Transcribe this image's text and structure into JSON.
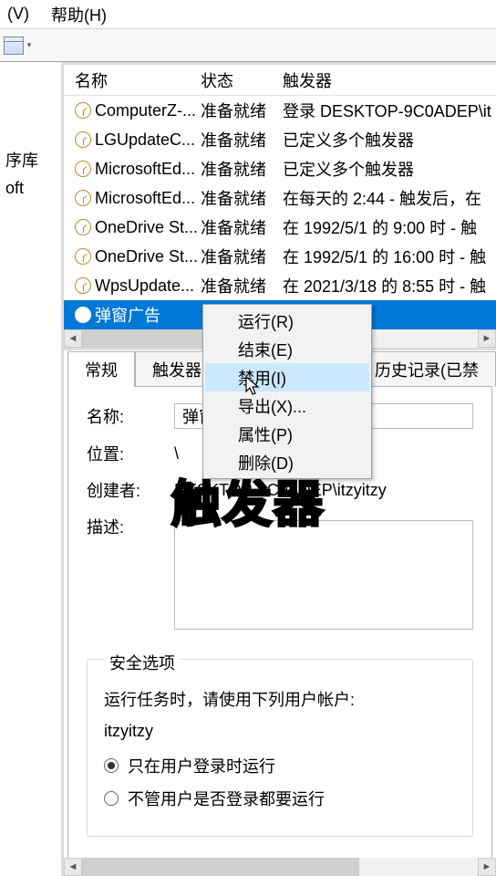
{
  "menubar": {
    "v": "(V)",
    "help": "帮助(H)"
  },
  "sidebar": {
    "lib": "序库",
    "oft": "oft"
  },
  "columns": {
    "name": "名称",
    "state": "状态",
    "trigger": "触发器"
  },
  "tasks": [
    {
      "name": "ComputerZ-...",
      "state": "准备就绪",
      "trigger": "登录 DESKTOP-9C0ADEP\\it"
    },
    {
      "name": "LGUpdateC...",
      "state": "准备就绪",
      "trigger": "已定义多个触发器"
    },
    {
      "name": "MicrosoftEd...",
      "state": "准备就绪",
      "trigger": "已定义多个触发器"
    },
    {
      "name": "MicrosoftEd...",
      "state": "准备就绪",
      "trigger": "在每天的 2:44 - 触发后，在"
    },
    {
      "name": "OneDrive St...",
      "state": "准备就绪",
      "trigger": "在 1992/5/1 的 9:00 时 - 触"
    },
    {
      "name": "OneDrive St...",
      "state": "准备就绪",
      "trigger": "在 1992/5/1 的 16:00 时 - 触"
    },
    {
      "name": "WpsUpdate...",
      "state": "准备就绪",
      "trigger": "在 2021/3/18 的 8:55 时 - 触"
    },
    {
      "name": "弹窗广告",
      "state": "",
      "trigger": ""
    }
  ],
  "context_menu": [
    {
      "label": "运行(R)"
    },
    {
      "label": "结束(E)"
    },
    {
      "label": "禁用(I)",
      "hover": true
    },
    {
      "label": "导出(X)..."
    },
    {
      "label": "属性(P)"
    },
    {
      "label": "删除(D)"
    }
  ],
  "tabs": {
    "general": "常规",
    "triggers": "触发器",
    "history": "历史记录(已禁"
  },
  "form": {
    "name_label": "名称:",
    "name_value": "弹窗",
    "location_label": "位置:",
    "location_value": "\\",
    "creator_label": "创建者:",
    "creator_value": "DESKTOP-9C0ADEP\\itzyitzy",
    "description_label": "描述:"
  },
  "security": {
    "legend": "安全选项",
    "line1": "运行任务时，请使用下列用户帐户:",
    "account": "itzyitzy",
    "opt1": "只在用户登录时运行",
    "opt2": "不管用户是否登录都要运行"
  },
  "overlay": "触发器"
}
